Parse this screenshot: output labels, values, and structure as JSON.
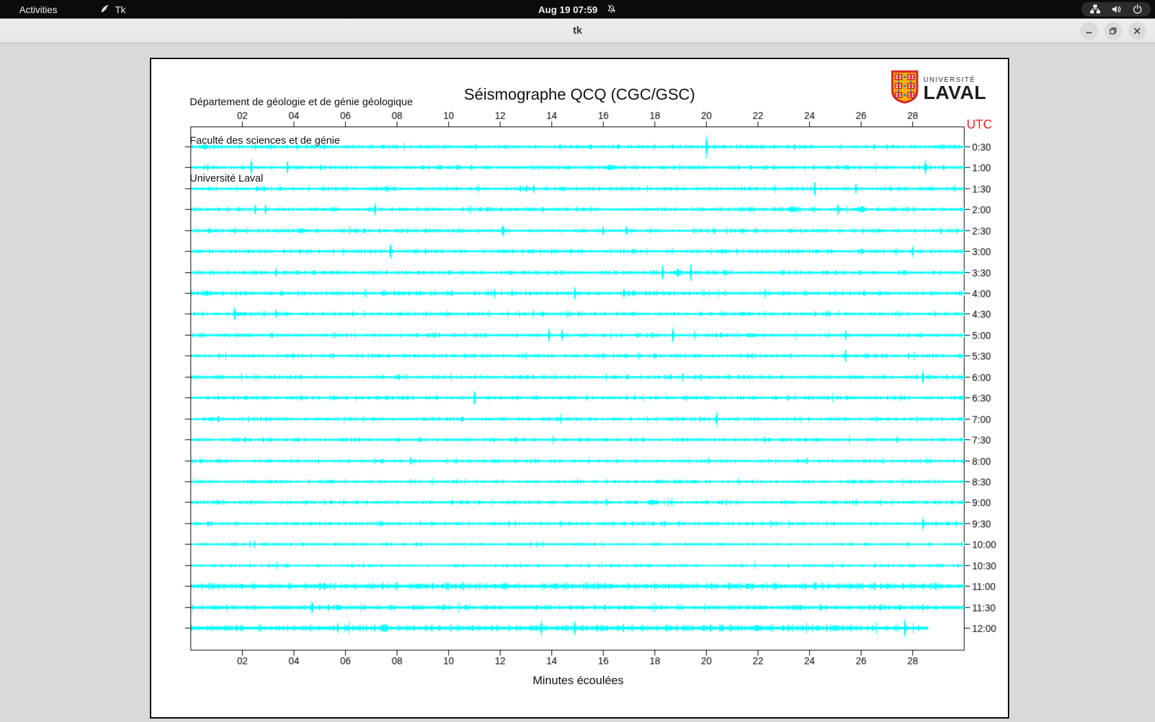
{
  "top_bar": {
    "activities_label": "Activities",
    "app_indicator_label": "Tk",
    "clock": "Aug 19 07:59"
  },
  "window": {
    "title": "tk"
  },
  "document": {
    "header_lines": [
      "Département de géologie et de génie géologique",
      "Faculté des sciences et de génie",
      "Université Laval"
    ],
    "logo": {
      "line1": "UNIVERSITÉ",
      "line2": "LAVAL"
    },
    "utc_label": "UTC"
  },
  "colors": {
    "trace": "#00ffff",
    "axis": "#000000",
    "utc_label": "#fb1d1d",
    "window_bg": "#d9d9d9",
    "logo_red": "#d62828",
    "logo_gold": "#f7b500",
    "logo_blue": "#1f86c9"
  },
  "chart_data": {
    "type": "line",
    "title": "Séismographe QCQ (CGC/GSC)",
    "xlabel": "Minutes écoulées",
    "y_axis_unit": "UTC",
    "x_range_minutes": [
      0,
      30
    ],
    "x_tick_labels": [
      "02",
      "04",
      "06",
      "08",
      "10",
      "12",
      "14",
      "16",
      "18",
      "20",
      "22",
      "24",
      "26",
      "28"
    ],
    "trace_color": "#00ffff",
    "rows_note": "24 half-hour seismogram traces; spikes = [minute, half-amplitude px, width-minutes (0 = sharp)]",
    "rows": [
      {
        "time": "0:30",
        "noise": 1.0,
        "end_minute": 30,
        "spikes": [
          [
            0.55,
            4,
            0.35
          ],
          [
            20.0,
            17,
            0
          ]
        ]
      },
      {
        "time": "1:00",
        "noise": 1.0,
        "end_minute": 30,
        "spikes": [
          [
            2.35,
            13,
            0
          ],
          [
            3.75,
            10,
            0
          ],
          [
            10.4,
            4,
            0.2
          ],
          [
            10.9,
            5,
            0
          ],
          [
            16.3,
            4,
            0.5
          ],
          [
            28.5,
            12,
            0
          ]
        ]
      },
      {
        "time": "1:30",
        "noise": 1.0,
        "end_minute": 30,
        "spikes": [
          [
            13.3,
            7,
            0
          ],
          [
            24.2,
            11,
            0
          ],
          [
            25.8,
            8,
            0
          ]
        ]
      },
      {
        "time": "2:00",
        "noise": 1.0,
        "end_minute": 30,
        "spikes": [
          [
            2.5,
            8,
            0
          ],
          [
            2.9,
            8,
            0
          ],
          [
            7.15,
            10,
            0
          ],
          [
            23.3,
            4,
            0.5
          ],
          [
            25.1,
            9,
            0
          ],
          [
            26.0,
            5,
            0.4
          ]
        ]
      },
      {
        "time": "2:30",
        "noise": 1.0,
        "end_minute": 30,
        "spikes": [
          [
            4.3,
            4,
            0.4
          ],
          [
            12.1,
            9,
            0
          ],
          [
            16.0,
            7,
            0
          ],
          [
            16.9,
            7,
            0
          ],
          [
            23.3,
            4,
            0
          ]
        ]
      },
      {
        "time": "3:00",
        "noise": 1.0,
        "end_minute": 30,
        "spikes": [
          [
            7.75,
            11,
            0
          ],
          [
            28.0,
            9,
            0
          ]
        ]
      },
      {
        "time": "3:30",
        "noise": 1.0,
        "end_minute": 30,
        "spikes": [
          [
            3.3,
            7,
            0
          ],
          [
            18.3,
            12,
            0
          ],
          [
            18.9,
            6,
            0.3
          ],
          [
            19.4,
            14,
            0
          ]
        ]
      },
      {
        "time": "4:00",
        "noise": 1.1,
        "end_minute": 30,
        "spikes": [
          [
            0.6,
            4,
            0.5
          ],
          [
            14.9,
            10,
            0
          ],
          [
            16.8,
            8,
            0
          ]
        ]
      },
      {
        "time": "4:30",
        "noise": 1.0,
        "end_minute": 30,
        "spikes": [
          [
            1.7,
            10,
            0
          ],
          [
            3.3,
            7,
            0
          ]
        ]
      },
      {
        "time": "5:00",
        "noise": 1.0,
        "end_minute": 30,
        "spikes": [
          [
            13.9,
            11,
            0
          ],
          [
            14.4,
            9,
            0
          ],
          [
            18.7,
            12,
            0
          ],
          [
            21.8,
            4,
            0.5
          ],
          [
            25.4,
            8,
            0
          ]
        ]
      },
      {
        "time": "5:30",
        "noise": 1.0,
        "end_minute": 30,
        "spikes": [
          [
            25.4,
            10,
            0
          ]
        ]
      },
      {
        "time": "6:00",
        "noise": 1.0,
        "end_minute": 30,
        "spikes": [
          [
            28.4,
            11,
            0
          ]
        ]
      },
      {
        "time": "6:30",
        "noise": 1.0,
        "end_minute": 30,
        "spikes": [
          [
            11.0,
            11,
            0
          ]
        ]
      },
      {
        "time": "7:00",
        "noise": 0.95,
        "end_minute": 30,
        "spikes": [
          [
            20.4,
            11,
            0
          ]
        ]
      },
      {
        "time": "7:30",
        "noise": 0.95,
        "end_minute": 30,
        "spikes": [
          [
            12.4,
            3,
            0
          ]
        ]
      },
      {
        "time": "8:00",
        "noise": 0.9,
        "end_minute": 30,
        "spikes": []
      },
      {
        "time": "8:30",
        "noise": 0.9,
        "end_minute": 30,
        "spikes": [
          [
            19.5,
            3,
            0
          ]
        ]
      },
      {
        "time": "9:00",
        "noise": 0.95,
        "end_minute": 30,
        "spikes": [
          [
            17.9,
            5,
            0.3
          ]
        ]
      },
      {
        "time": "9:30",
        "noise": 0.95,
        "end_minute": 30,
        "spikes": [
          [
            17.9,
            3,
            0
          ],
          [
            28.4,
            10,
            0
          ]
        ]
      },
      {
        "time": "10:00",
        "noise": 0.8,
        "end_minute": 30,
        "spikes": []
      },
      {
        "time": "10:30",
        "noise": 0.8,
        "end_minute": 30,
        "spikes": []
      },
      {
        "time": "11:00",
        "noise": 1.5,
        "end_minute": 30,
        "spikes": [
          [
            14.2,
            4,
            0.2
          ],
          [
            16.3,
            4,
            0.2
          ],
          [
            21.6,
            4,
            0.2
          ],
          [
            27.0,
            5,
            0.2
          ],
          [
            28.4,
            5,
            0
          ]
        ]
      },
      {
        "time": "11:30",
        "noise": 1.25,
        "end_minute": 30,
        "spikes": [
          [
            4.7,
            10,
            0
          ],
          [
            28.4,
            6,
            0
          ]
        ]
      },
      {
        "time": "12:00",
        "noise": 1.5,
        "end_minute": 28.6,
        "spikes": [
          [
            5.7,
            8,
            0
          ],
          [
            7.5,
            6,
            0.4
          ],
          [
            13.6,
            12,
            0
          ],
          [
            14.9,
            11,
            0
          ],
          [
            22.0,
            5,
            0.5
          ],
          [
            25.0,
            5,
            0.3
          ],
          [
            27.7,
            14,
            0
          ]
        ]
      }
    ]
  }
}
